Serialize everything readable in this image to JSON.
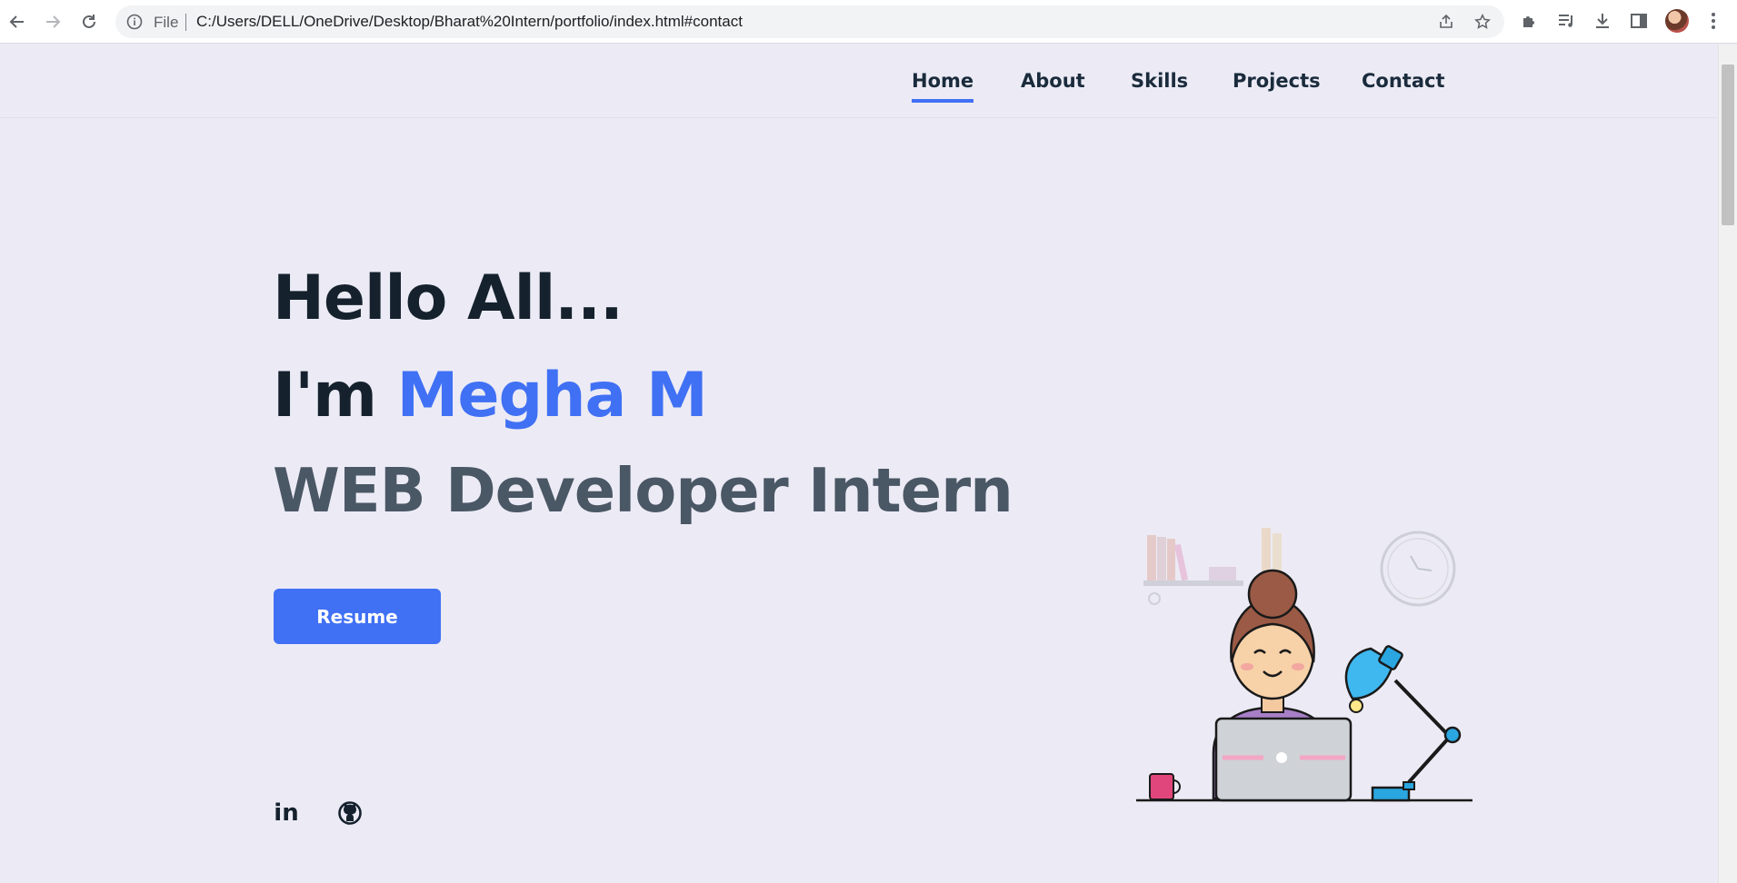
{
  "browser": {
    "file_label": "File",
    "url": "C:/Users/DELL/OneDrive/Desktop/Bharat%20Intern/portfolio/index.html#contact",
    "icons": [
      "back-icon",
      "forward-icon",
      "reload-icon",
      "info-icon",
      "share-icon",
      "star-icon",
      "extensions-icon",
      "media-icon",
      "download-icon",
      "side-panel-icon",
      "profile-avatar",
      "menu-icon"
    ]
  },
  "nav": {
    "items": [
      {
        "label": "Home",
        "active": true
      },
      {
        "label": "About",
        "active": false
      },
      {
        "label": "Skills",
        "active": false
      },
      {
        "label": "Projects",
        "active": false
      },
      {
        "label": "Contact",
        "active": false
      }
    ]
  },
  "hero": {
    "greeting": "Hello All...",
    "intro_prefix": "I'm ",
    "name": "Megha M",
    "role": "WEB Developer Intern",
    "resume_label": "Resume"
  },
  "social": {
    "linkedin_text": "in",
    "icons": [
      "linkedin-icon",
      "github-icon"
    ]
  },
  "colors": {
    "accent": "#4070f4",
    "heading": "#15222e",
    "subheading": "#4a5765",
    "background": "#ecebf5"
  }
}
